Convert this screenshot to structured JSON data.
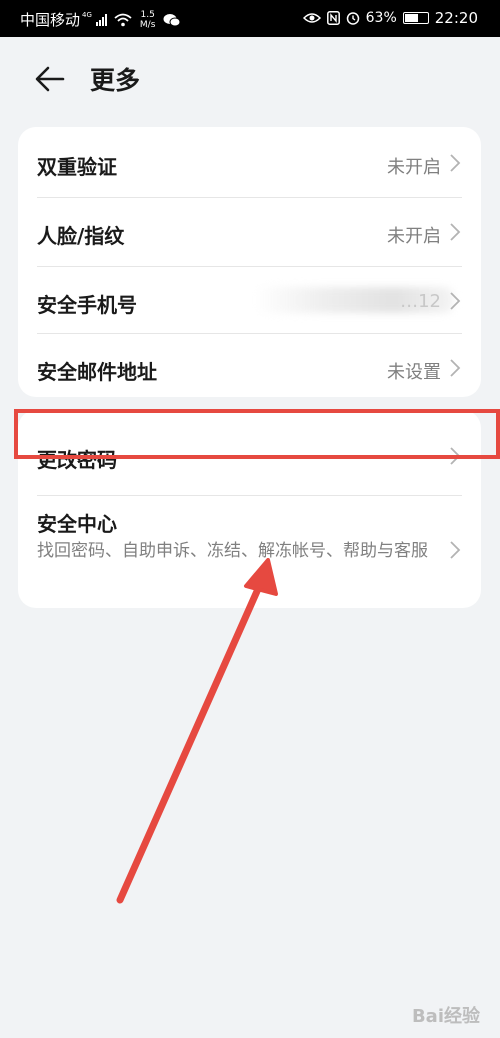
{
  "status_bar": {
    "carrier": "中国移动",
    "network_tag": "4G",
    "speed_value": "1.5",
    "speed_unit": "M/s",
    "battery": "63%",
    "battery_level": 0.63,
    "time": "22:20",
    "icons": [
      "wifi-icon",
      "wechat-icon",
      "eye-icon",
      "nfc-icon",
      "alarm-icon",
      "battery-icon"
    ]
  },
  "header": {
    "title": "更多",
    "back_icon": "back-arrow-icon"
  },
  "security_list": [
    {
      "label": "双重验证",
      "value": "未开启"
    },
    {
      "label": "人脸/指纹",
      "value": "未开启"
    },
    {
      "label": "安全手机号",
      "value": "…12"
    },
    {
      "label": "安全邮件地址",
      "value": "未设置"
    }
  ],
  "account_list": {
    "change_password": {
      "label": "更改密码"
    },
    "security_center": {
      "label": "安全中心",
      "description": "找回密码、自助申诉、冻结、解冻帐号、帮助与客服"
    }
  },
  "annotation": {
    "highlight_color": "#e64940",
    "watermark": "Bai经验"
  }
}
